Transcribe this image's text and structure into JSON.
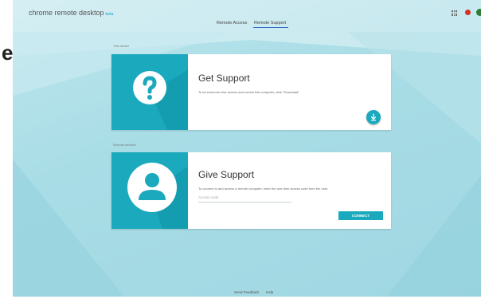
{
  "edge": {
    "char": "e"
  },
  "header": {
    "app_name": "chrome remote desktop",
    "beta": "beta",
    "tabs": [
      {
        "label": "Remote Access",
        "active": false
      },
      {
        "label": "Remote Support",
        "active": true
      }
    ]
  },
  "sections": {
    "this_device": "This device",
    "remote_devices": "Remote devices"
  },
  "get_support": {
    "title": "Get Support",
    "description": "To let someone else access and control this computer, click \"Download\""
  },
  "give_support": {
    "title": "Give Support",
    "description": "To connect to and access a remote computer, enter the one-time access code from the user.",
    "access_code_placeholder": "Access code",
    "connect_label": "CONNECT"
  },
  "footer": {
    "send_feedback": "Send Feedback",
    "help": "Help"
  },
  "colors": {
    "accent": "#1aa9bd",
    "background": "#a9dde6",
    "tab_underline": "#3b6bc4"
  }
}
